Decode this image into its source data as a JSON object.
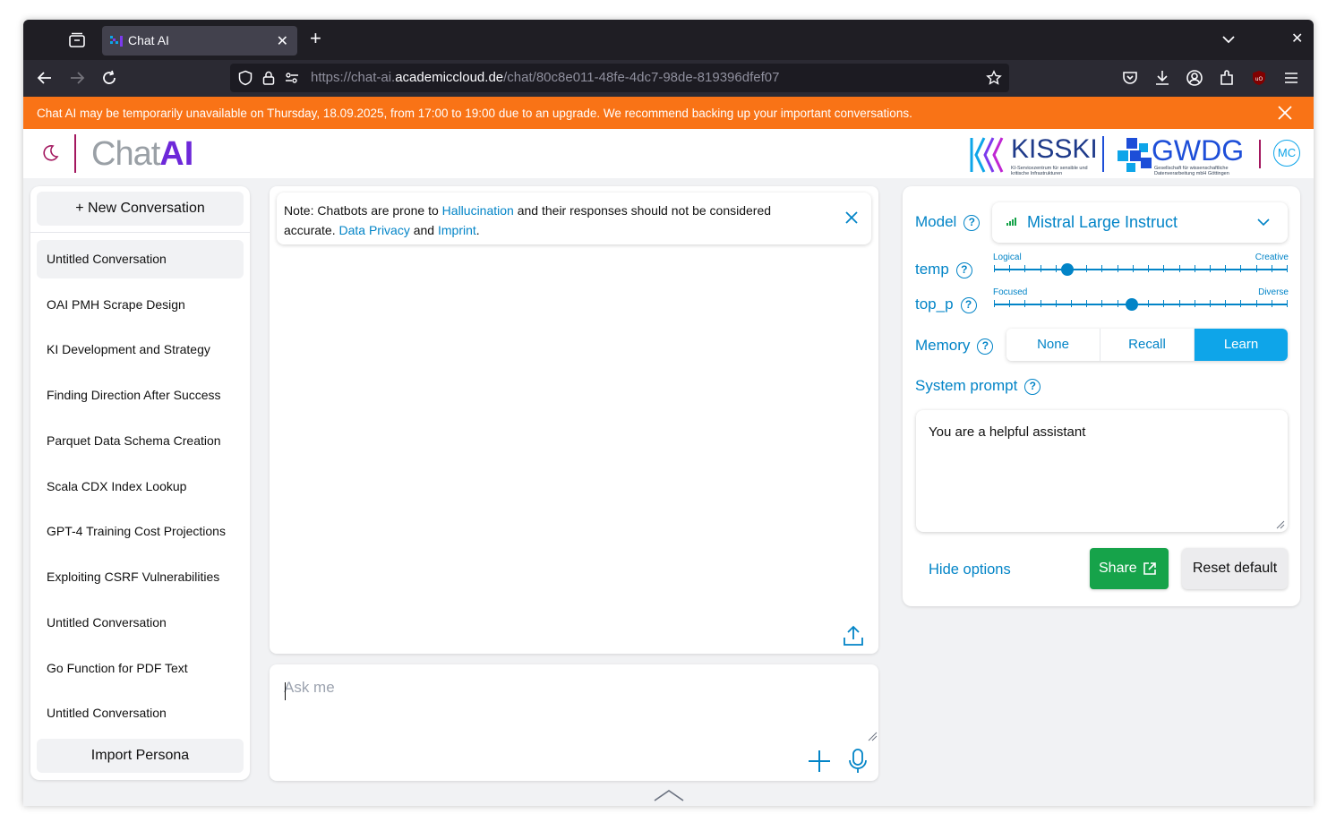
{
  "browser": {
    "tab_title": "Chat AI",
    "url_prefix": "https://chat-ai.",
    "url_domain": "academiccloud.de",
    "url_path": "/chat/80c8e011-48fe-4dc7-98de-819396dfef07"
  },
  "banner": {
    "message": "Chat AI may be temporarily unavailable on Thursday, 18.09.2025, from 17:00 to 19:00 due to an upgrade. We recommend backing up your important conversations."
  },
  "header": {
    "logo_chat": "Chat",
    "logo_ai": "AI",
    "kisski_name": "KISSKI",
    "kisski_sub": "KI-Servicezentrum für sensible und kritische Infrastrukturen",
    "gwdg_name": "GWDG",
    "gwdg_sub": "Gesellschaft für wissenschaftliche Datenverarbeitung mbH Göttingen",
    "avatar_initials": "MC"
  },
  "sidebar": {
    "new_conversation": "+ New Conversation",
    "import_persona": "Import Persona",
    "conversations": [
      "Untitled Conversation",
      "OAI PMH Scrape Design",
      "KI Development and Strategy",
      "Finding Direction After Success",
      "Parquet Data Schema Creation",
      "Scala CDX Index Lookup",
      "GPT-4 Training Cost Projections",
      "Exploiting CSRF Vulnerabilities",
      "Untitled Conversation",
      "Go Function for PDF Text",
      "Untitled Conversation"
    ]
  },
  "note": {
    "prefix": "Note: Chatbots are prone to ",
    "hallucination": "Hallucination",
    "middle": " and their responses should not be considered accurate. ",
    "privacy": "Data Privacy",
    "and": " and ",
    "imprint": "Imprint",
    "suffix": "."
  },
  "input": {
    "placeholder": "Ask me"
  },
  "settings": {
    "model_label": "Model",
    "model_value": "Mistral Large Instruct",
    "temp_label": "temp",
    "temp_left": "Logical",
    "temp_right": "Creative",
    "temp_value": 0.25,
    "top_p_label": "top_p",
    "top_p_left": "Focused",
    "top_p_right": "Diverse",
    "top_p_value": 0.47,
    "memory_label": "Memory",
    "memory_options": [
      "None",
      "Recall",
      "Learn"
    ],
    "memory_selected": "Learn",
    "system_prompt_label": "System prompt",
    "system_prompt_value": "You are a helpful assistant",
    "hide_options": "Hide options",
    "share": "Share",
    "reset_default": "Reset default"
  },
  "colors": {
    "banner": "#f97316",
    "accent": "#0284c7",
    "share": "#16a34a",
    "memory_active": "#0ea5e9"
  }
}
